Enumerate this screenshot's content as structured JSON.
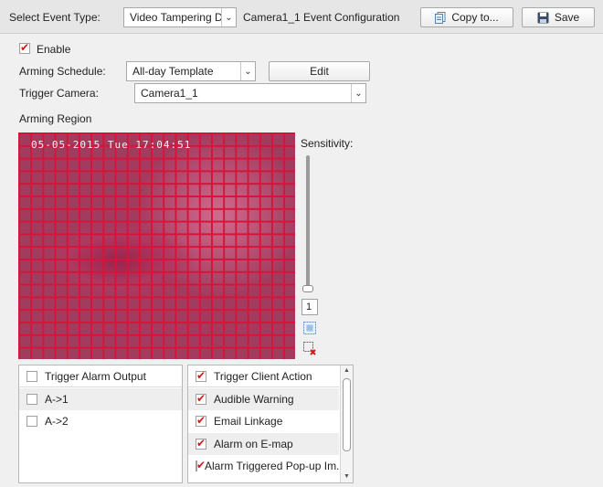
{
  "toolbar": {
    "event_type_label": "Select Event Type:",
    "event_type_value": "Video Tampering Det...",
    "config_title": "Camera1_1 Event Configuration",
    "copy_label": "Copy to...",
    "save_label": "Save"
  },
  "form": {
    "enable_label": "Enable",
    "enable_checked": true,
    "schedule_label": "Arming Schedule:",
    "schedule_value": "All-day Template",
    "edit_label": "Edit",
    "camera_label": "Trigger Camera:",
    "camera_value": "Camera1_1",
    "region_label": "Arming Region"
  },
  "video": {
    "timestamp": "05-05-2015 Tue 17:04:51"
  },
  "sensitivity": {
    "label": "Sensitivity:",
    "value": "1"
  },
  "alarm_outputs": {
    "items": [
      {
        "label": "Trigger Alarm Output",
        "checked": false
      },
      {
        "label": "A->1",
        "checked": false
      },
      {
        "label": "A->2",
        "checked": false
      }
    ]
  },
  "client_actions": {
    "items": [
      {
        "label": "Trigger Client Action",
        "checked": true
      },
      {
        "label": "Audible Warning",
        "checked": true
      },
      {
        "label": "Email Linkage",
        "checked": true
      },
      {
        "label": "Alarm on E-map",
        "checked": true
      },
      {
        "label": "Alarm Triggered Pop-up Im...",
        "checked": true
      }
    ]
  },
  "colors": {
    "grid": "#d8133a",
    "check_mark": "#d11a1a"
  }
}
